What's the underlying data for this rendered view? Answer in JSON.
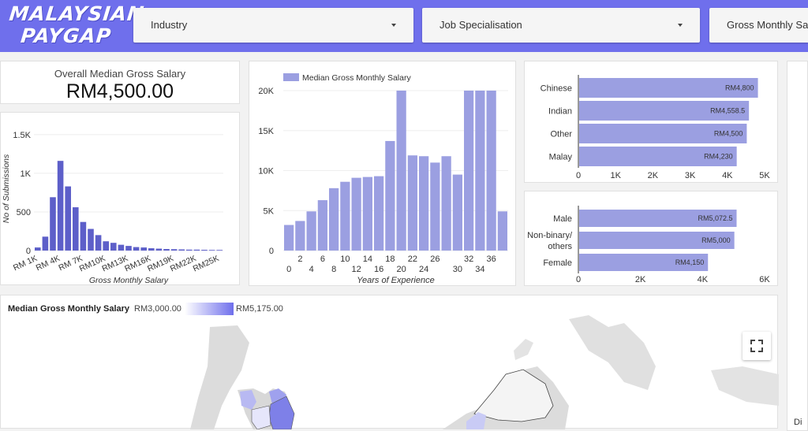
{
  "logo": {
    "line1": "MALAYSIAN",
    "line2": "PAYGAP"
  },
  "filters": [
    {
      "label": "Industry"
    },
    {
      "label": "Job Specialisation"
    },
    {
      "label": "Gross Monthly Sala"
    }
  ],
  "kpi": {
    "label": "Overall Median Gross Salary",
    "value": "RM4,500.00"
  },
  "colors": {
    "accent": "#6f6fec",
    "bar": "#9b9fe1",
    "hist": "#5d5fc9"
  },
  "histogram": {
    "chart_data": {
      "type": "bar",
      "xlabel": "Gross Monthly Salary",
      "ylabel": "No of Submissions",
      "yticks": [
        "1.5K",
        "1K",
        "500",
        "0"
      ],
      "ylim": [
        0,
        1600
      ],
      "xticks": [
        "RM 1K",
        "RM 4K",
        "RM 7K",
        "RM10K",
        "RM13K",
        "RM16K",
        "RM19K",
        "RM22K",
        "RM25K"
      ],
      "values": [
        40,
        180,
        690,
        1160,
        830,
        560,
        370,
        280,
        200,
        120,
        100,
        75,
        60,
        45,
        40,
        30,
        25,
        20,
        18,
        15,
        12,
        12,
        10,
        8,
        8
      ]
    }
  },
  "experience": {
    "chart_data": {
      "type": "bar",
      "legend": "Median Gross Monthly Salary",
      "xlabel": "Years of Experience",
      "yticks": [
        "20K",
        "15K",
        "10K",
        "5K",
        "0"
      ],
      "ylim": [
        0,
        20000
      ],
      "xticks_top": [
        "2",
        "6",
        "10",
        "14",
        "18",
        "22",
        "26",
        "32",
        "36"
      ],
      "xticks_bottom": [
        "0",
        "4",
        "8",
        "12",
        "16",
        "20",
        "24",
        "30",
        "34"
      ],
      "values": [
        3200,
        3700,
        4900,
        6300,
        7800,
        8600,
        9100,
        9200,
        9300,
        13700,
        20000,
        11900,
        11800,
        11000,
        11800,
        9500,
        20000,
        20000,
        20000,
        4900
      ]
    }
  },
  "ethnicity": {
    "chart_data": {
      "type": "bar",
      "categories": [
        "Chinese",
        "Indian",
        "Other",
        "Malay"
      ],
      "values": [
        4800,
        4558.5,
        4500,
        4230
      ],
      "data_labels": [
        "RM4,800",
        "RM4,558.5",
        "RM4,500",
        "RM4,230"
      ],
      "xticks": [
        "0",
        "1K",
        "2K",
        "3K",
        "4K",
        "5K"
      ],
      "xlim": [
        0,
        5000
      ]
    }
  },
  "gender": {
    "chart_data": {
      "type": "bar",
      "categories": [
        "Male",
        "Non-binary/ others",
        "Female"
      ],
      "categories_lines": [
        [
          "Male"
        ],
        [
          "Non-binary/",
          "others"
        ],
        [
          "Female"
        ]
      ],
      "values": [
        5072.5,
        5000,
        4150
      ],
      "data_labels": [
        "RM5,072.5",
        "RM5,000",
        "RM4,150"
      ],
      "xticks": [
        "0",
        "2K",
        "4K",
        "6K"
      ],
      "xlim": [
        0,
        6000
      ]
    }
  },
  "map": {
    "title": "Median Gross Monthly Salary",
    "min_label": "RM3,000.00",
    "max_label": "RM5,175.00"
  },
  "edge_text": "Di"
}
